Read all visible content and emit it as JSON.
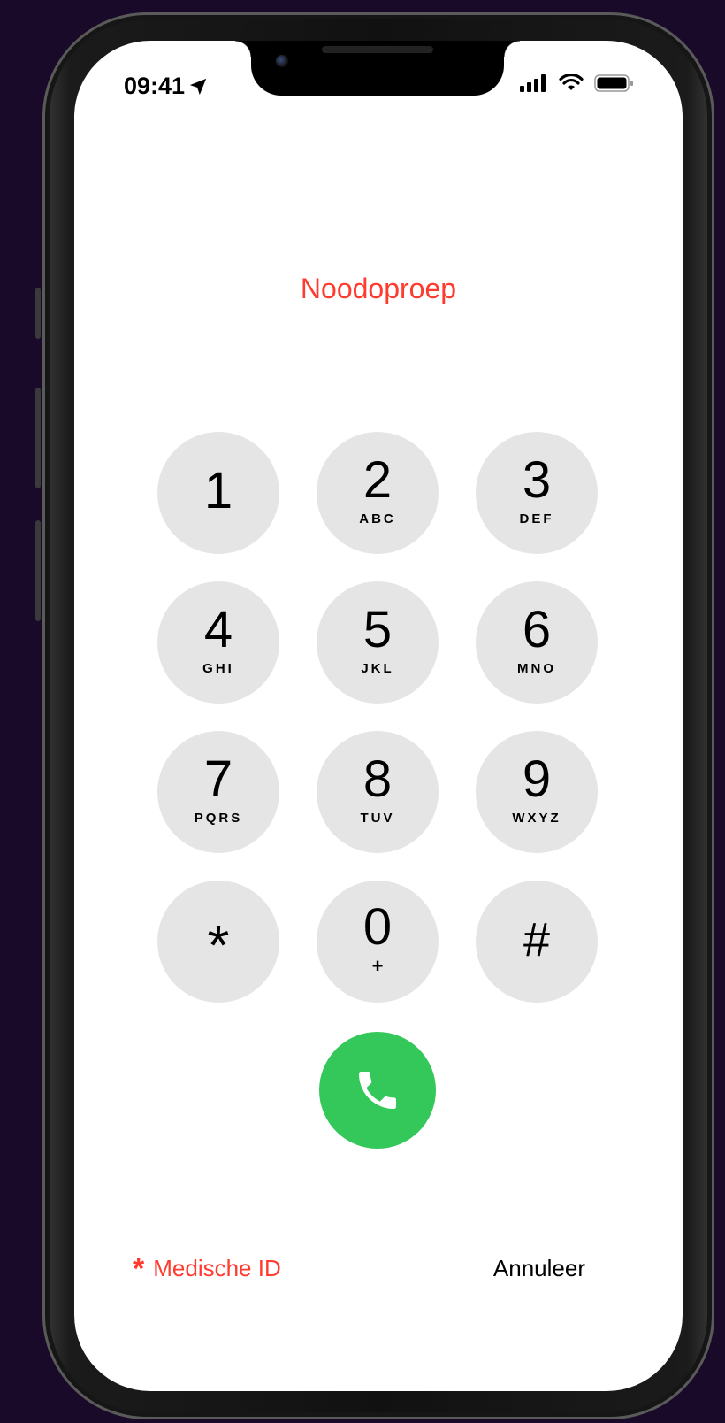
{
  "status_bar": {
    "time": "09:41"
  },
  "title": "Noodoproep",
  "keypad": [
    {
      "digit": "1",
      "letters": ""
    },
    {
      "digit": "2",
      "letters": "ABC"
    },
    {
      "digit": "3",
      "letters": "DEF"
    },
    {
      "digit": "4",
      "letters": "GHI"
    },
    {
      "digit": "5",
      "letters": "JKL"
    },
    {
      "digit": "6",
      "letters": "MNO"
    },
    {
      "digit": "7",
      "letters": "PQRS"
    },
    {
      "digit": "8",
      "letters": "TUV"
    },
    {
      "digit": "9",
      "letters": "WXYZ"
    },
    {
      "digit": "*",
      "letters": ""
    },
    {
      "digit": "0",
      "letters": "+"
    },
    {
      "digit": "#",
      "letters": ""
    }
  ],
  "footer": {
    "medical_id_label": "Medische ID",
    "medical_id_icon": "*",
    "cancel_label": "Annuleer"
  },
  "colors": {
    "accent_red": "#ff3b30",
    "call_green": "#34c759",
    "key_background": "#e5e5e5"
  },
  "icons": [
    "location-arrow-icon",
    "cellular-signal-icon",
    "wifi-icon",
    "battery-icon",
    "phone-icon"
  ]
}
